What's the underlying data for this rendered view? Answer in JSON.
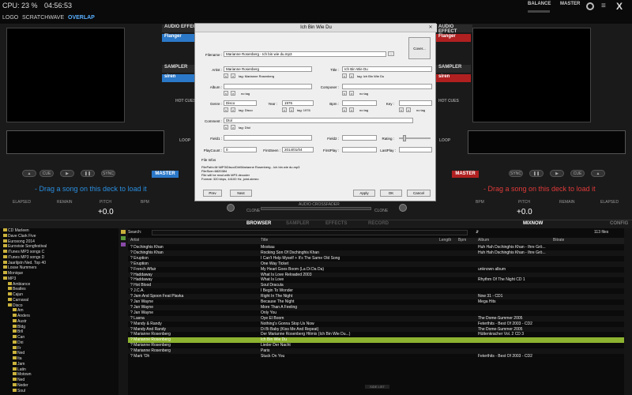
{
  "app": {
    "cpu": "CPU: 23 %",
    "time": "04:56:53",
    "tabs": [
      "LOGO",
      "SCRATCHWAVE",
      "OVERLAP"
    ],
    "balance": "BALANCE",
    "master": "MASTER",
    "close": "X"
  },
  "deck": {
    "audio_effect": "AUDIO EFFECT",
    "effect_name": "Flanger",
    "sampler": "SAMPLER",
    "sampler_name": "siren",
    "hot_cues": "HOT CUES",
    "loop": "LOOP",
    "master_label": "MASTER",
    "load_msg": "- Drag a song on this deck to load it",
    "elapsed": "ELAPSED",
    "remain": "REMAIN",
    "pitch": "PITCH",
    "bpm": "BPM",
    "pitch_value": "+0.0",
    "cue": "CUE",
    "sync": "SYNC",
    "in": "IN",
    "out": "OUT",
    "clone": "CLONE",
    "crossfader": "AUDIO CROSSFADER"
  },
  "dialog": {
    "title": "Ich Bin Wie Du",
    "filename_label": "Filename :",
    "filename": "Marianne Rosenberg - Ich bin wie du.mp3",
    "cover": "Cover...",
    "artist_label": "Artist :",
    "artist": "Marianne Rosenberg",
    "artist_tag": "tag: Marianne Rosenberg",
    "title_label": "Title :",
    "title_tag": "tag: Ich Bin Wie Du",
    "album_label": "Album :",
    "album_tag": "no tag",
    "composer_label": "Composer :",
    "composer_tag": "no tag",
    "genre_label": "Genre :",
    "genre": "Disco",
    "genre_tag": "tag: Disco",
    "year_label": "Year :",
    "year": "1976",
    "year_tag": "tag: 1976",
    "bpm_label": "Bpm :",
    "bpm_tag": "no tag",
    "key_label": "Key :",
    "key_tag": "no tag",
    "comment_label": "Comment :",
    "comment": "Dtol",
    "comment_tag": "tag: Dtol",
    "field1_label": "Field1 :",
    "field2_label": "Field2 :",
    "rating_label": "Rating :",
    "playcount_label": "PlayCount :",
    "playcount": "0",
    "firstseen_label": "FirstSeen :",
    "firstseen": "2014/01/04",
    "firstplay_label": "FirstPlay :",
    "lastplay_label": "LastPlay :",
    "info_title": "File Infos",
    "info_lines": [
      "FilePath=M:\\MP3\\Disco\\Diri\\Marianne Rosenberg - Ich bin wie du.mp3",
      "FileSize=6820384",
      "File will be read with MP3 decoder",
      "Format: 320 kbps, 44100 Hz, joint-stereo"
    ],
    "prev": "Prev",
    "next": "Next",
    "apply": "Apply",
    "ok": "OK",
    "cancel": "Cancel"
  },
  "browser": {
    "tabs": [
      "BROWSER",
      "SAMPLER",
      "EFFECTS",
      "RECORD"
    ],
    "mixnow": "MIXNOW",
    "config": "CONFIG",
    "search_label": "Search:",
    "files_count": "113 files",
    "columns": [
      "Artist",
      "Title",
      "Length",
      "Bpm",
      "Album",
      "Bitrate"
    ],
    "sidelist": "SIDE LIST"
  },
  "tree": [
    "CD Marleen",
    "Dave Clark Five",
    "Eurosong 2014",
    "Eurovisie Songfestival",
    "iTunes MP3 songs C",
    "iTunes MP3 songs D",
    "Jaarlijstn Ned. Top 40",
    "Losse Nummers",
    "Monique",
    "MP3",
    "Ambiance",
    "Beatles",
    "Cajun",
    "Carnaval",
    "Disco",
    "Am",
    "Anders",
    "Austr",
    "Bldg",
    "Brll",
    "Can",
    "Diri",
    "Fr",
    "Ned",
    "Ita",
    "Jam",
    "Latin",
    "Motown",
    "Ned",
    "Neder",
    "Soul"
  ],
  "tracks": [
    {
      "artist": "Dschinghis Khan",
      "title": "Moskau",
      "album": "Huh Hah Dschinghis Khan - Ihre Grö..."
    },
    {
      "artist": "Dschinghis Khan",
      "title": "Rocking Son Of Dschinghis Khan",
      "album": "Huh Hah Dschinghis Khan - Ihre Grö..."
    },
    {
      "artist": "Eruption",
      "title": "I Can't Help Myself + It's The Same Old Song",
      "album": ""
    },
    {
      "artist": "Eruption",
      "title": "One Way Ticket",
      "album": ""
    },
    {
      "artist": "French Affair",
      "title": "My Heart Goes Boom (La Di Da Da)",
      "album": "unknown album"
    },
    {
      "artist": "Haddaway",
      "title": "What Is Love Reloaded 2003",
      "album": ""
    },
    {
      "artist": "Haddaway",
      "title": "What Is Love",
      "album": "Rhythm Of The Night CD 1"
    },
    {
      "artist": "Hot Blood",
      "title": "Soul Dracula",
      "album": ""
    },
    {
      "artist": "J.C.A.",
      "title": "I Begin To Wonder",
      "album": ""
    },
    {
      "artist": "Jam And Spoon Feat Plavka",
      "title": "Right In The Night",
      "album": "Now 31 - CD1"
    },
    {
      "artist": "Jan Wayne",
      "title": "Because The Night",
      "album": "Mega Hits"
    },
    {
      "artist": "Jan Wayne",
      "title": "More Than A Feeling",
      "album": ""
    },
    {
      "artist": "Jan Wayne",
      "title": "Only You",
      "album": ""
    },
    {
      "artist": "Lasna",
      "title": "Oye El Boom",
      "album": "The Dome-Summer 2005"
    },
    {
      "artist": "Mandy & Randy",
      "title": "Nothing's Gonna Stop Us Now",
      "album": "Feterthits - Best Of 2003 - CD2"
    },
    {
      "artist": "Mandy And Randy",
      "title": "Di Bi Baby (Kiss Me And Repeat)",
      "album": "The Dome-Summer 2005"
    },
    {
      "artist": "Marianne Rosenberg",
      "title": "Der Marianne Rosenberg Hitmix (Ich Bin Wie Du...)",
      "album": "Hüttenkracher Vol. 2 CD 3"
    },
    {
      "artist": "Marianne Rosenberg",
      "title": "Ich Bin Wie Du",
      "album": ""
    },
    {
      "artist": "Marianne Rosenberg",
      "title": "Lieder Der Nacht",
      "album": ""
    },
    {
      "artist": "Marianne Rosenberg",
      "title": "Paris",
      "album": ""
    },
    {
      "artist": "Mark 'Oh",
      "title": "Stuck On You",
      "album": "Feterthits - Best Of 2003 - CD2"
    }
  ]
}
